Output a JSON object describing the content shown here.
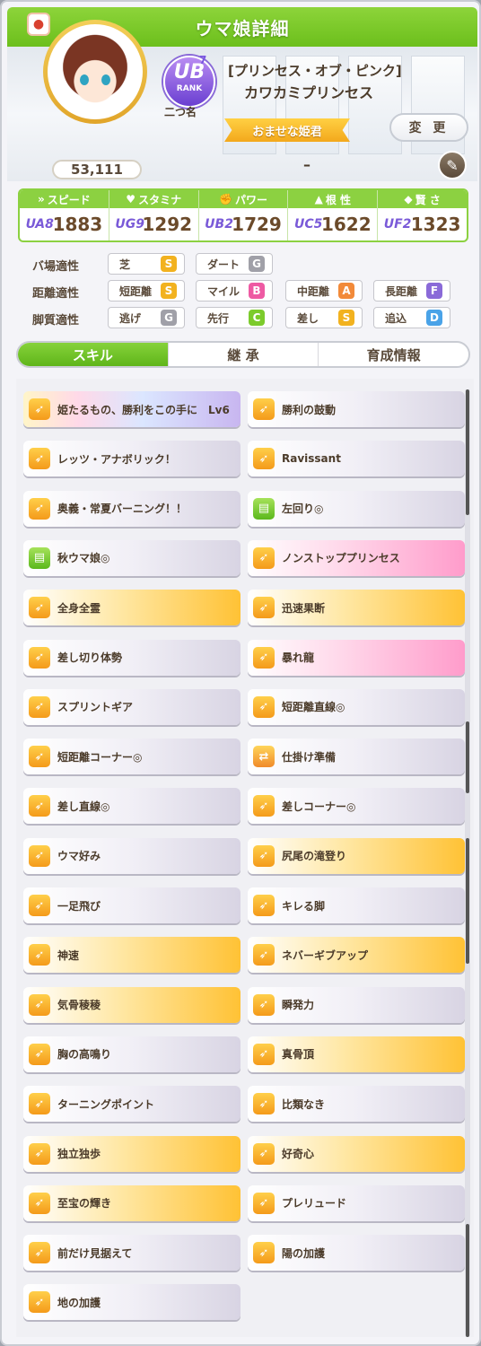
{
  "title": "ウマ娘詳細",
  "profile": {
    "fans": "53,111",
    "rank_badge": "UB",
    "rank_label": "RANK",
    "rank_number": "7",
    "nickname_label": "二つ名",
    "epithet": "[プリンセス・オブ・ピンク]",
    "name": "カワカミプリンセス",
    "title_badge": "おませな姫君",
    "change_button": "変 更",
    "secondary": "–"
  },
  "stats": [
    {
      "label": "スピード",
      "icon": "speed-icon",
      "grade": "UA8",
      "value": "1883"
    },
    {
      "label": "スタミナ",
      "icon": "heart-icon",
      "grade": "UG9",
      "value": "1292"
    },
    {
      "label": "パワー",
      "icon": "muscle-icon",
      "grade": "UB2",
      "value": "1729"
    },
    {
      "label": "根 性",
      "icon": "flame-icon",
      "grade": "UC5",
      "value": "1622"
    },
    {
      "label": "賢 さ",
      "icon": "graduation-cap-icon",
      "grade": "UF2",
      "value": "1323"
    }
  ],
  "aptitude": {
    "track": {
      "label": "バ場適性",
      "items": [
        {
          "name": "芝",
          "grade": "S"
        },
        {
          "name": "ダート",
          "grade": "G"
        }
      ]
    },
    "distance": {
      "label": "距離適性",
      "items": [
        {
          "name": "短距離",
          "grade": "S"
        },
        {
          "name": "マイル",
          "grade": "B"
        },
        {
          "name": "中距離",
          "grade": "A"
        },
        {
          "name": "長距離",
          "grade": "F"
        }
      ]
    },
    "style": {
      "label": "脚質適性",
      "items": [
        {
          "name": "逃げ",
          "grade": "G"
        },
        {
          "name": "先行",
          "grade": "C"
        },
        {
          "name": "差し",
          "grade": "S"
        },
        {
          "name": "追込",
          "grade": "D"
        }
      ]
    }
  },
  "tabs": [
    "スキル",
    "継 承",
    "育成情報"
  ],
  "skills": [
    {
      "name": "姫たるもの、勝利をこの手に　Lv6",
      "type": "rainbow",
      "icon": "run-icon"
    },
    {
      "name": "勝利の鼓動",
      "type": "normal",
      "icon": "run-icon"
    },
    {
      "name": "レッツ・アナボリック！",
      "type": "normal",
      "icon": "run-icon"
    },
    {
      "name": "Ravissant",
      "type": "normal",
      "icon": "run-icon"
    },
    {
      "name": "奥義・常夏バーニング！！",
      "type": "normal",
      "icon": "run-icon"
    },
    {
      "name": "左回り◎",
      "type": "normal",
      "icon": "green-ticket-icon"
    },
    {
      "name": "秋ウマ娘◎",
      "type": "normal",
      "icon": "green-ticket-icon"
    },
    {
      "name": "ノンストッププリンセス",
      "type": "unique",
      "icon": "run-icon"
    },
    {
      "name": "全身全霊",
      "type": "gold",
      "icon": "run-icon"
    },
    {
      "name": "迅速果断",
      "type": "gold",
      "icon": "run-icon"
    },
    {
      "name": "差し切り体勢",
      "type": "normal",
      "icon": "run-icon"
    },
    {
      "name": "暴れ龍",
      "type": "unique",
      "icon": "run-icon"
    },
    {
      "name": "スプリントギア",
      "type": "normal",
      "icon": "run-icon"
    },
    {
      "name": "短距離直線◎",
      "type": "normal",
      "icon": "run-icon"
    },
    {
      "name": "短距離コーナー◎",
      "type": "normal",
      "icon": "run-icon"
    },
    {
      "name": "仕掛け準備",
      "type": "normal",
      "icon": "arrows-icon"
    },
    {
      "name": "差し直線◎",
      "type": "normal",
      "icon": "run-icon"
    },
    {
      "name": "差しコーナー◎",
      "type": "normal",
      "icon": "run-icon"
    },
    {
      "name": "ウマ好み",
      "type": "normal",
      "icon": "run-icon"
    },
    {
      "name": "尻尾の滝登り",
      "type": "gold",
      "icon": "run-icon"
    },
    {
      "name": "一足飛び",
      "type": "normal",
      "icon": "run-icon"
    },
    {
      "name": "キレる脚",
      "type": "normal",
      "icon": "run-icon"
    },
    {
      "name": "神速",
      "type": "gold",
      "icon": "run-icon"
    },
    {
      "name": "ネバーギブアップ",
      "type": "gold",
      "icon": "run-icon"
    },
    {
      "name": "気骨稜稜",
      "type": "gold",
      "icon": "run-icon"
    },
    {
      "name": "瞬発力",
      "type": "normal",
      "icon": "run-icon"
    },
    {
      "name": "胸の高鳴り",
      "type": "normal",
      "icon": "run-icon"
    },
    {
      "name": "真骨頂",
      "type": "gold",
      "icon": "run-icon"
    },
    {
      "name": "ターニングポイント",
      "type": "normal",
      "icon": "run-icon"
    },
    {
      "name": "比類なき",
      "type": "normal",
      "icon": "run-icon"
    },
    {
      "name": "独立独歩",
      "type": "gold",
      "icon": "run-icon"
    },
    {
      "name": "好奇心",
      "type": "gold",
      "icon": "run-icon"
    },
    {
      "name": "至宝の輝き",
      "type": "gold",
      "icon": "run-icon"
    },
    {
      "name": "プレリュード",
      "type": "normal",
      "icon": "run-icon"
    },
    {
      "name": "前だけ見据えて",
      "type": "normal",
      "icon": "run-icon"
    },
    {
      "name": "陽の加護",
      "type": "normal",
      "icon": "run-icon"
    },
    {
      "name": "地の加護",
      "type": "normal",
      "icon": "run-icon"
    }
  ],
  "colors": {
    "accent": "#7ccb2c",
    "grade_S": "#f2b21f",
    "grade_A": "#f28a3a",
    "grade_B": "#ee5aa3",
    "grade_C": "#7ccb2c",
    "grade_D": "#4aa3e8",
    "grade_F": "#8a6ad8",
    "grade_G": "#a0a0a8"
  }
}
